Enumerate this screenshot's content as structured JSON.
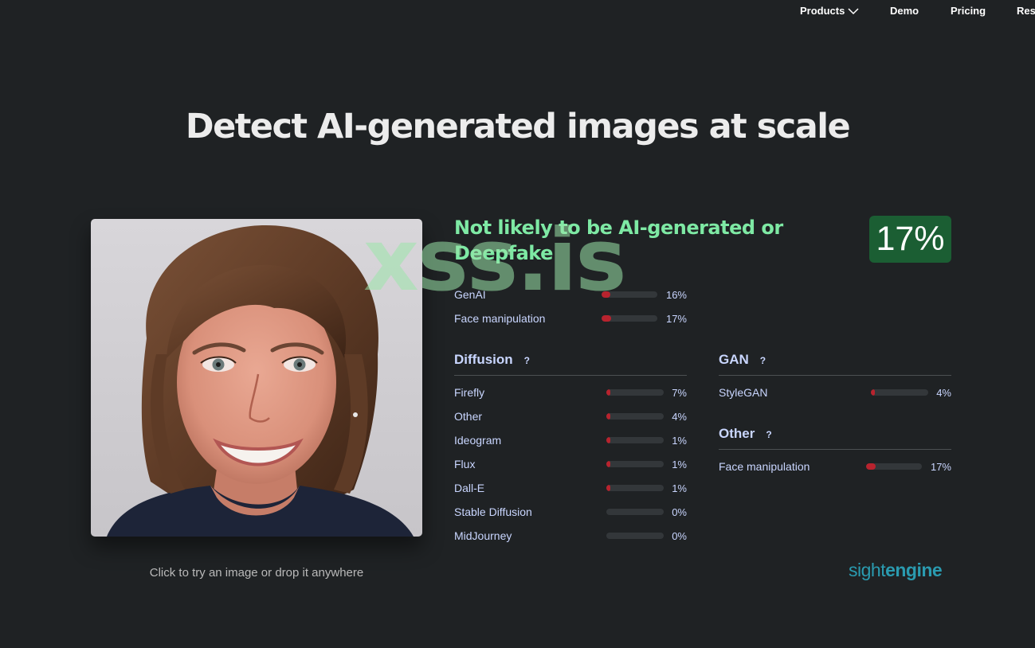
{
  "nav": {
    "products": "Products",
    "demo": "Demo",
    "pricing": "Pricing",
    "resources": "Res"
  },
  "title": "Detect AI-generated images at scale",
  "drop_hint": "Click to try an image or drop it anywhere",
  "verdict": "Not likely to be AI-generated or Deepfake",
  "score": "17%",
  "watermark": "xss.is",
  "summary": [
    {
      "label": "GenAI",
      "percent": 16,
      "value": "16%"
    },
    {
      "label": "Face manipulation",
      "percent": 17,
      "value": "17%"
    }
  ],
  "diffusion": {
    "title": "Diffusion",
    "help": "?",
    "items": [
      {
        "label": "Firefly",
        "percent": 7,
        "value": "7%"
      },
      {
        "label": "Other",
        "percent": 4,
        "value": "4%"
      },
      {
        "label": "Ideogram",
        "percent": 1,
        "value": "1%"
      },
      {
        "label": "Flux",
        "percent": 1,
        "value": "1%"
      },
      {
        "label": "Dall-E",
        "percent": 1,
        "value": "1%"
      },
      {
        "label": "Stable Diffusion",
        "percent": 0,
        "value": "0%"
      },
      {
        "label": "MidJourney",
        "percent": 0,
        "value": "0%"
      }
    ]
  },
  "gan": {
    "title": "GAN",
    "help": "?",
    "items": [
      {
        "label": "StyleGAN",
        "percent": 4,
        "value": "4%"
      }
    ]
  },
  "other": {
    "title": "Other",
    "help": "?",
    "items": [
      {
        "label": "Face manipulation",
        "percent": 17,
        "value": "17%"
      }
    ]
  },
  "logo": {
    "part1": "sight",
    "part2": "engine"
  },
  "colors": {
    "background": "#1f2224",
    "verdict": "#7ee9a4",
    "badge": "#1b5e33",
    "bar_fill": "#b8232e",
    "bar_track": "#33373a",
    "logo": "#2a9bb0"
  }
}
